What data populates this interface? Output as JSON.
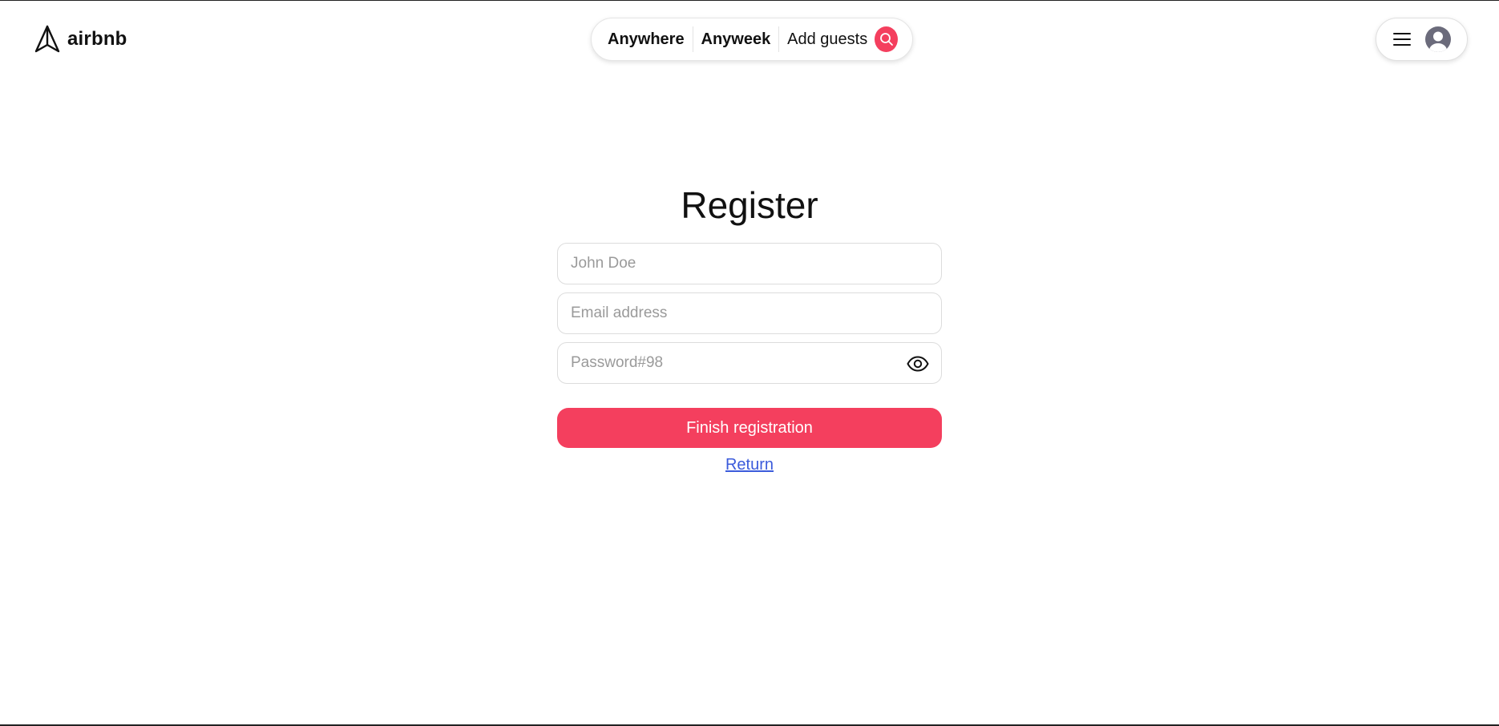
{
  "colors": {
    "accent": "#f43f5e",
    "link": "#3b5bdb",
    "avatar": "#6b6b7b"
  },
  "header": {
    "logo": {
      "icon": "paper-plane-icon",
      "text": "airbnb"
    },
    "search": {
      "location_label": "Anywhere",
      "week_label": "Anyweek",
      "guests_label": "Add guests",
      "search_icon": "search-icon"
    },
    "user_menu": {
      "menu_icon": "hamburger-menu-icon",
      "avatar_icon": "user-avatar-icon"
    }
  },
  "register": {
    "title": "Register",
    "name_placeholder": "John Doe",
    "email_placeholder": "Email address",
    "password_placeholder": "Password#98",
    "password_toggle_icon": "eye-icon",
    "submit_label": "Finish registration",
    "return_label": "Return"
  }
}
